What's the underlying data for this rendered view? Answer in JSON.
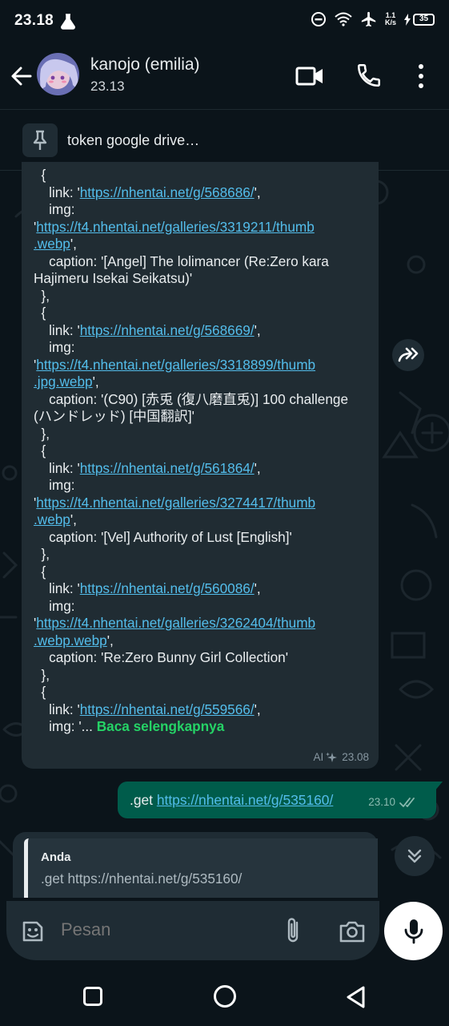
{
  "status_bar": {
    "time": "23.18",
    "speed_top": "1.1",
    "speed_bottom": "K/s",
    "battery": "35"
  },
  "header": {
    "contact_name": "kanojo (emilia)",
    "last_seen": "23.13",
    "icons": [
      "back-arrow-icon",
      "video-call-icon",
      "phone-icon",
      "more-vertical-icon"
    ]
  },
  "pinned": {
    "text": "token google drive…",
    "icon": "pin-icon"
  },
  "incoming_message": {
    "lines": [
      [
        {
          "t": "  {"
        }
      ],
      [
        {
          "t": "    link: '"
        },
        {
          "t": "https://nhentai.net/g/568686/",
          "link": true
        },
        {
          "t": "',"
        }
      ],
      [
        {
          "t": "    img:"
        }
      ],
      [
        {
          "t": "'"
        },
        {
          "t": "https://t4.nhentai.net/galleries/3319211/thumb",
          "link": true
        }
      ],
      [
        {
          "t": ".webp",
          "link": true
        },
        {
          "t": "',"
        }
      ],
      [
        {
          "t": "    caption: '[Angel] The lolimancer (Re:Zero kara"
        }
      ],
      [
        {
          "t": "Hajimeru Isekai Seikatsu)'"
        }
      ],
      [
        {
          "t": "  },"
        }
      ],
      [
        {
          "t": "  {"
        }
      ],
      [
        {
          "t": "    link: '"
        },
        {
          "t": "https://nhentai.net/g/568669/",
          "link": true
        },
        {
          "t": "',"
        }
      ],
      [
        {
          "t": "    img:"
        }
      ],
      [
        {
          "t": "'"
        },
        {
          "t": "https://t4.nhentai.net/galleries/3318899/thumb",
          "link": true
        }
      ],
      [
        {
          "t": ".jpg.webp",
          "link": true
        },
        {
          "t": "',"
        }
      ],
      [
        {
          "t": "    caption: '(C90) [赤兎 (復八磨直兎)] 100 challenge"
        }
      ],
      [
        {
          "t": "(ハンドレッド) [中国翻訳]'"
        }
      ],
      [
        {
          "t": "  },"
        }
      ],
      [
        {
          "t": "  {"
        }
      ],
      [
        {
          "t": "    link: '"
        },
        {
          "t": "https://nhentai.net/g/561864/",
          "link": true
        },
        {
          "t": "',"
        }
      ],
      [
        {
          "t": "    img:"
        }
      ],
      [
        {
          "t": "'"
        },
        {
          "t": "https://t4.nhentai.net/galleries/3274417/thumb",
          "link": true
        }
      ],
      [
        {
          "t": ".webp",
          "link": true
        },
        {
          "t": "',"
        }
      ],
      [
        {
          "t": "    caption: '[Vel] Authority of Lust [English]'"
        }
      ],
      [
        {
          "t": "  },"
        }
      ],
      [
        {
          "t": "  {"
        }
      ],
      [
        {
          "t": "    link: '"
        },
        {
          "t": "https://nhentai.net/g/560086/",
          "link": true
        },
        {
          "t": "',"
        }
      ],
      [
        {
          "t": "    img:"
        }
      ],
      [
        {
          "t": "'"
        },
        {
          "t": "https://t4.nhentai.net/galleries/3262404/thumb",
          "link": true
        }
      ],
      [
        {
          "t": ".webp.webp",
          "link": true
        },
        {
          "t": "',"
        }
      ],
      [
        {
          "t": "    caption: 'Re:Zero Bunny Girl Collection'"
        }
      ],
      [
        {
          "t": "  },"
        }
      ],
      [
        {
          "t": "  {"
        }
      ],
      [
        {
          "t": "    link: '"
        },
        {
          "t": "https://nhentai.net/g/559566/",
          "link": true
        },
        {
          "t": "',"
        }
      ],
      [
        {
          "t": "    img: '... "
        },
        {
          "t": "Baca selengkapnya",
          "more": true
        }
      ]
    ],
    "ai_label": "AI",
    "time": "23.08"
  },
  "outgoing_message": {
    "prefix": ".get ",
    "link": "https://nhentai.net/g/535160/",
    "time": "23.10"
  },
  "reply_preview": {
    "author": "Anda",
    "text": ".get https://nhentai.net/g/535160/"
  },
  "composer": {
    "placeholder": "Pesan",
    "icons": [
      "emoji-icon",
      "attach-icon",
      "camera-icon",
      "mic-icon"
    ]
  },
  "colors": {
    "background": "#0b141a",
    "incoming_bubble": "#202c33",
    "outgoing_bubble": "#005c4b",
    "link": "#53bdeb",
    "read_more": "#25d366"
  }
}
